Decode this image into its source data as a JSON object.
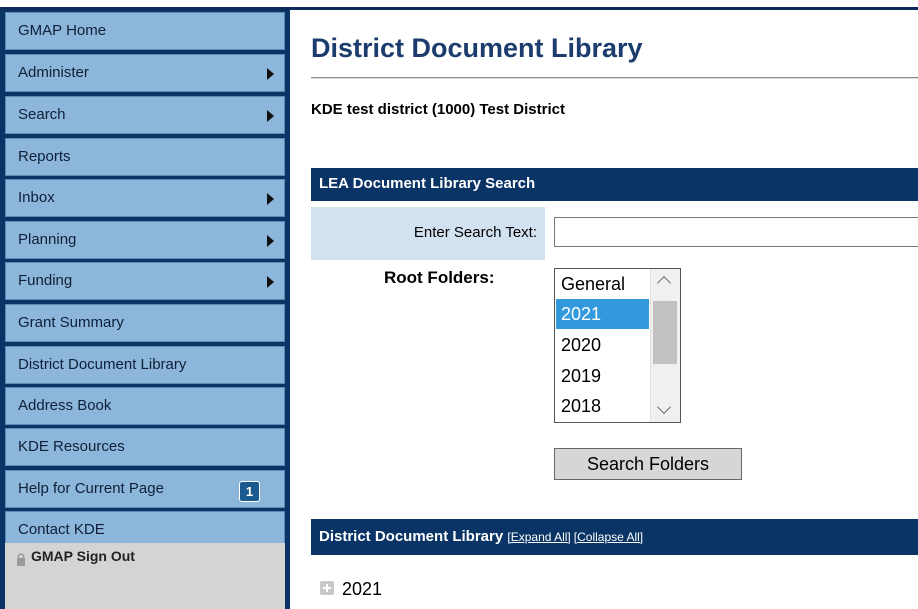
{
  "nav": {
    "items": [
      {
        "label": "GMAP Home",
        "arrow": false
      },
      {
        "label": "Administer",
        "arrow": true
      },
      {
        "label": "Search",
        "arrow": true
      },
      {
        "label": "Reports",
        "arrow": false
      },
      {
        "label": "Inbox",
        "arrow": true
      },
      {
        "label": "Planning",
        "arrow": true
      },
      {
        "label": "Funding",
        "arrow": true
      },
      {
        "label": "Grant Summary",
        "arrow": false
      },
      {
        "label": "District Document Library",
        "arrow": false
      },
      {
        "label": "Address Book",
        "arrow": false
      },
      {
        "label": "KDE Resources",
        "arrow": false
      },
      {
        "label": "Help for Current Page",
        "arrow": false,
        "badge": "1"
      },
      {
        "label": "Contact KDE",
        "arrow": false
      }
    ],
    "signout": {
      "label": "GMAP Sign Out",
      "icon": "lock-icon"
    }
  },
  "main": {
    "title": "District Document Library",
    "district": "KDE test district (1000) Test District",
    "search_panel": {
      "header": "LEA Document Library Search",
      "search_label": "Enter Search Text:",
      "search_value": "",
      "root_label": "Root Folders:",
      "folders": [
        "General",
        "2021",
        "2020",
        "2019",
        "2018"
      ],
      "selected_folder": "2021",
      "button": "Search Folders"
    },
    "library": {
      "header": "District Document Library",
      "expand_all": "[Expand All]",
      "collapse_all": "[Collapse All]",
      "tree": [
        {
          "label": "2021",
          "icon": "plus-expand-icon"
        }
      ]
    }
  },
  "colors": {
    "nav_bg": "#0b3466",
    "nav_item": "#8cb6da",
    "title": "#1b3c6c",
    "header_bg": "#0b3466",
    "selected": "#3399dd"
  }
}
